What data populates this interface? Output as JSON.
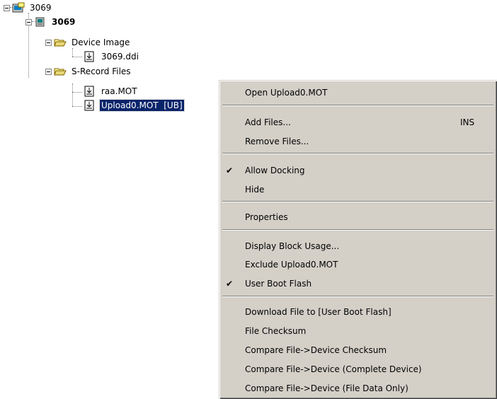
{
  "tree": {
    "root_label": "3069",
    "device_label": "3069",
    "device_image_folder": "Device Image",
    "device_image_file": "3069.ddi",
    "srecord_folder": "S-Record Files",
    "file1": "raa.MOT",
    "file2_selected": "Upload0.MOT  [UB]"
  },
  "menu": {
    "open": "Open Upload0.MOT",
    "add_files": "Add Files...",
    "add_files_shortcut": "INS",
    "remove_files": "Remove Files...",
    "allow_docking": "Allow Docking",
    "allow_docking_checked": true,
    "hide": "Hide",
    "properties": "Properties",
    "display_block_usage": "Display Block Usage...",
    "exclude": "Exclude Upload0.MOT",
    "user_boot_flash": "User Boot Flash",
    "user_boot_flash_checked": true,
    "download_file": "Download File to [User Boot Flash]",
    "file_checksum": "File Checksum",
    "compare_checksum": "Compare File->Device Checksum",
    "compare_complete": "Compare File->Device (Complete Device)",
    "compare_file_data": "Compare File->Device (File Data Only)",
    "check_glyph": "✔"
  }
}
